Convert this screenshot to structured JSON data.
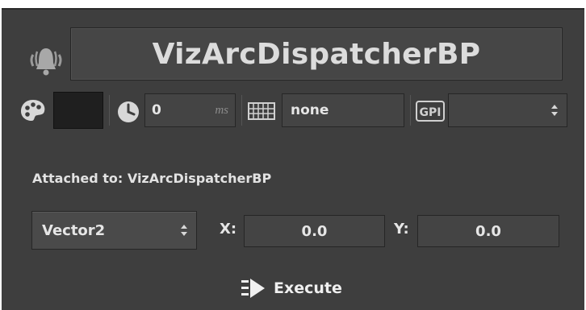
{
  "title": "VizArcDispatcherBP",
  "timing": {
    "delay_value": "0",
    "delay_unit": "ms"
  },
  "key": {
    "value": "none"
  },
  "gpi": {
    "label": "GPI",
    "selected": ""
  },
  "attached": {
    "text": "Attached to: VizArcDispatcherBP"
  },
  "param": {
    "type": "Vector2",
    "x_label": "X:",
    "x_value": "0.0",
    "y_label": "Y:",
    "y_value": "0.0"
  },
  "execute": {
    "label": "Execute"
  },
  "colors": {
    "panel": "#3e3e3e",
    "field": "#444444",
    "swatch": "#1f1f1f"
  },
  "icons": [
    "bell-icon",
    "palette-icon",
    "clock-icon",
    "keyboard-icon",
    "gpi-icon",
    "execute-icon",
    "updown-arrows-icon"
  ]
}
